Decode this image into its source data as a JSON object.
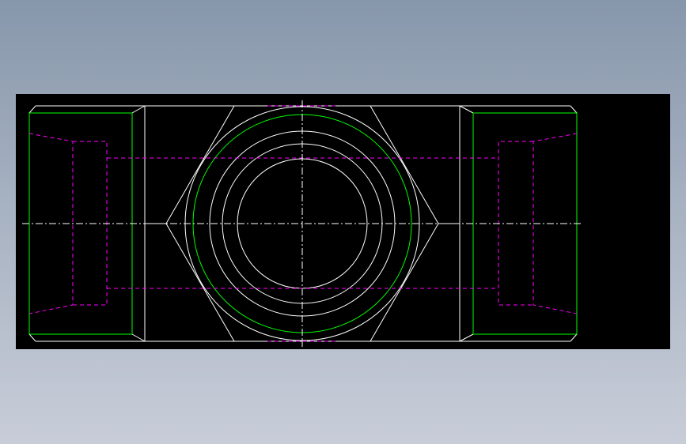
{
  "canvas": {
    "background": "#000000",
    "desktop_top": "#8797ab",
    "desktop_bottom": "#c8cdd8"
  },
  "colors": {
    "outline": "#ffffff",
    "thread": "#00ff00",
    "hidden": "#ff00ff",
    "center": "#ffffff"
  },
  "drawing": {
    "view": "top-view",
    "part": "hex-body-tee-fitting",
    "layers": [
      "outline",
      "thread",
      "hidden",
      "centerline"
    ]
  }
}
